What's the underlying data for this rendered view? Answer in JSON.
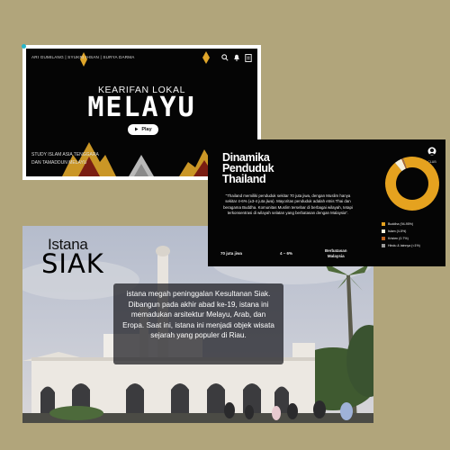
{
  "card_video": {
    "authors": "ARI GUMILANG | SYUKRI IHSAN | SURYA DARMA",
    "icons": [
      "search-icon",
      "bell-icon",
      "bookmark-icon"
    ],
    "pretitle": "KEARIFAN LOKAL",
    "title": "MELAYU",
    "play_label": "Play",
    "subtitle_line1": "STUDY ISLAM ASIA TENGGARA",
    "subtitle_line2": "DAN TAMADDUN MELAYU",
    "accent": "#f2b42a"
  },
  "card_thailand": {
    "title_line1": "Dinamika",
    "title_line2": "Penduduk",
    "title_line3": "Thailand",
    "body": "\"Thailand memiliki penduduk sekitar 70 juta jiwa, dengan Muslim hanya sekitar 4-6% (±3-4 juta jiwa). Mayoritas penduduk adalah etnis Thai dan beragama Buddha. Komunitas Muslim tersebar di berbagai wilayah, tetapi terkonsentrasi di wilayah selatan yang berbatasan dengan Malaysia\".",
    "stat_population": "70 juta jiwa",
    "stat_muslim": "4 – 6%",
    "stat_border_line1": "Berbatasan",
    "stat_border_line2": "Malaysia",
    "logo_text": "CLUB",
    "legend": [
      {
        "label": "Buddha (94-95%)",
        "color": "#e5a21f"
      },
      {
        "label": "Islam (4-5%)",
        "color": "#f5f0dc"
      },
      {
        "label": "Kristen (0.7%)",
        "color": "#c0641f"
      },
      {
        "label": "Hindu & lainnya (<1%)",
        "color": "#9a9a9a"
      }
    ],
    "chart_data": {
      "type": "pie",
      "categories": [
        "Buddha (94-95%)",
        "Islam (4-5%)",
        "Kristen (0.7%)",
        "Hindu & lainnya (<1%)"
      ],
      "values": [
        94.5,
        4.5,
        0.7,
        0.3
      ],
      "colors": [
        "#e5a21f",
        "#f5f0dc",
        "#c0641f",
        "#9a9a9a"
      ],
      "legend_position": "right"
    }
  },
  "card_siak": {
    "title_small": "Istana",
    "title_big": "SIAK",
    "description": "istana megah peninggalan Kesultanan Siak. Dibangun pada akhir abad ke-19, istana ini memadukan arsitektur Melayu, Arab, dan Eropa. Saat ini, istana ini menjadi objek wisata sejarah yang populer di Riau."
  }
}
